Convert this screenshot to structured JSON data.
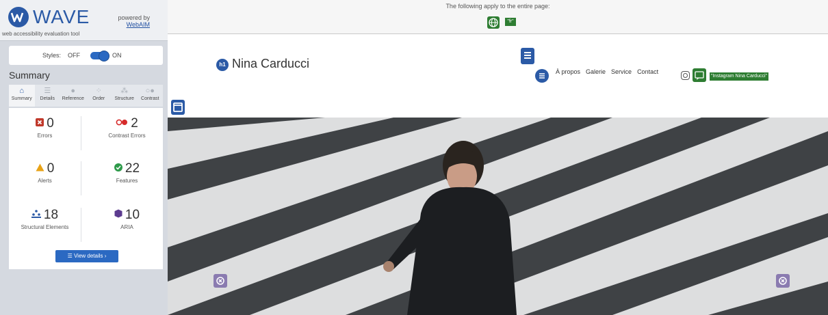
{
  "wave": {
    "logo_text": "WAVE",
    "logo_sub": "web accessibility evaluation tool",
    "powered_by": "powered by",
    "webaim_link": "WebAIM",
    "styles_label": "Styles:",
    "styles_off": "OFF",
    "styles_on": "ON",
    "summary_title": "Summary",
    "tabs": [
      {
        "label": "Summary",
        "icon": "home-icon"
      },
      {
        "label": "Details",
        "icon": "list-icon"
      },
      {
        "label": "Reference",
        "icon": "info-icon"
      },
      {
        "label": "Order",
        "icon": "order-icon"
      },
      {
        "label": "Structure",
        "icon": "structure-icon"
      },
      {
        "label": "Contrast",
        "icon": "contrast-icon"
      }
    ],
    "stats": {
      "errors": {
        "value": "0",
        "label": "Errors"
      },
      "contrast_errors": {
        "value": "2",
        "label": "Contrast Errors"
      },
      "alerts": {
        "value": "0",
        "label": "Alerts"
      },
      "features": {
        "value": "22",
        "label": "Features"
      },
      "structural": {
        "value": "18",
        "label": "Structural Elements"
      },
      "aria": {
        "value": "10",
        "label": "ARIA"
      }
    },
    "view_details": "View details ›",
    "colors": {
      "error": "#c0392b",
      "contrast": "#d62b2b",
      "alert": "#e8a317",
      "feature": "#2e9a4a",
      "structure": "#2b5aa6",
      "aria": "#5c3b8f",
      "accent": "#2b69c2"
    }
  },
  "page": {
    "topbar_text": "The following apply to the entire page:",
    "lang_tag": "\"fr\"",
    "brand_badge": "h1",
    "brand_name": "Nina Carducci",
    "nav": [
      "À propos",
      "Galerie",
      "Service",
      "Contact"
    ],
    "alt_tag": "\"Instagram Nina Carducci\""
  }
}
